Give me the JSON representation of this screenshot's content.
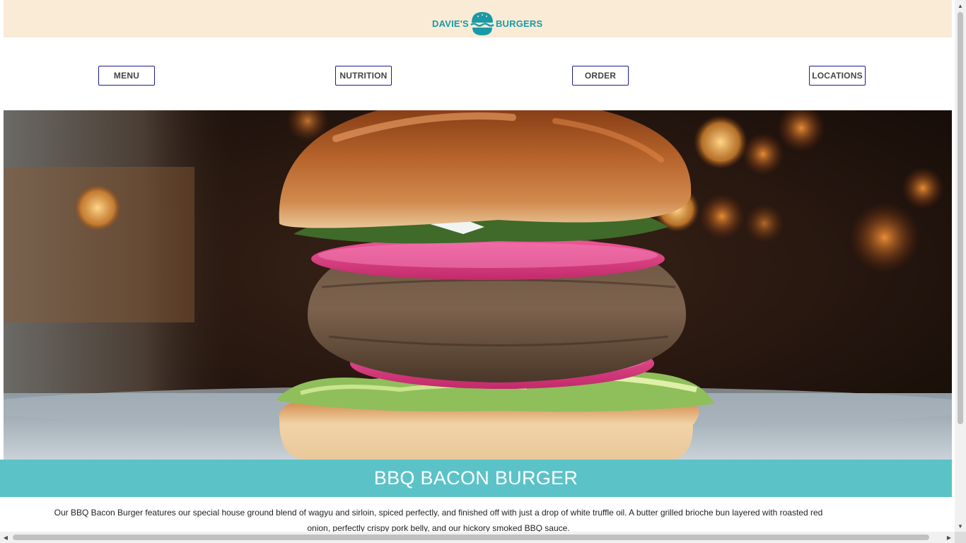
{
  "brand": {
    "left_word": "DAVIE'S",
    "right_word": "BURGERS",
    "color": "#1a9aa6"
  },
  "header": {
    "background": "#faebd7"
  },
  "nav": {
    "items": [
      {
        "label": "MENU"
      },
      {
        "label": "NUTRITION"
      },
      {
        "label": "ORDER"
      },
      {
        "label": "LOCATIONS"
      }
    ],
    "border_color": "#1b1b8f"
  },
  "hero": {
    "image": "burger-photo",
    "caption": "BBQ BACON BURGER",
    "caption_background": "#5bc3c8"
  },
  "description": {
    "text": "Our BBQ Bacon Burger features our special house ground blend of wagyu and sirloin, spiced perfectly, and finished off with just a drop of white truffle oil. A butter grilled brioche bun layered with roasted red onion, perfectly crispy pork belly, and our hickory smoked BBQ sauce."
  },
  "scrollbars": {
    "vertical": {
      "up": "▲",
      "down": "▼"
    },
    "horizontal": {
      "left": "◀",
      "right": "▶"
    }
  }
}
